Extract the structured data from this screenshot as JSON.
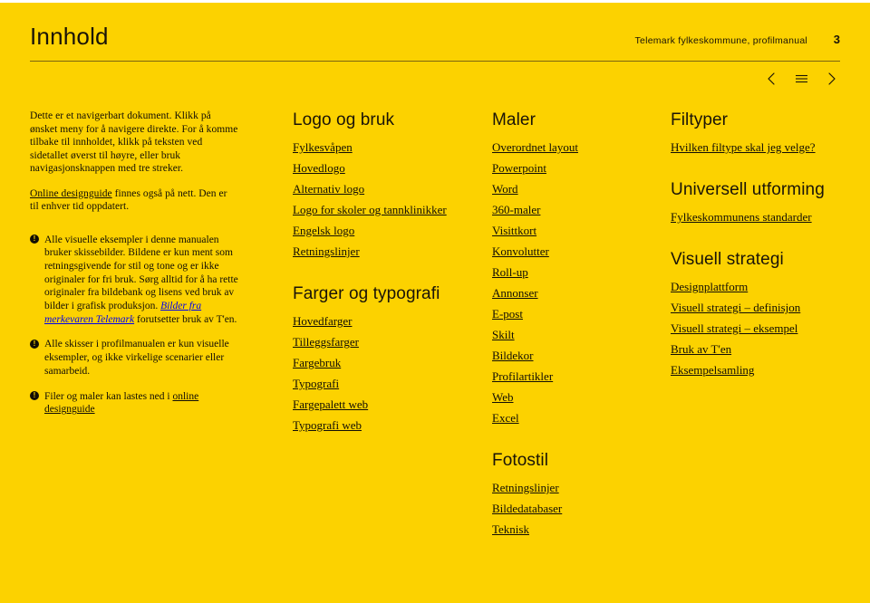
{
  "header": {
    "title": "Innhold",
    "doc_title": "Telemark fylkeskommune, profilmanual",
    "page_number": "3",
    "nav": {
      "prev_label": "Forrige side",
      "menu_label": "Meny",
      "next_label": "Neste side"
    }
  },
  "colors": {
    "background": "#fcd200",
    "text": "#120e05",
    "rule": "#7b6410"
  },
  "intro": {
    "paragraph_1": "Dette er et navigerbart dokument. Klikk på ønsket meny for å navigere direkte. For å komme tilbake til innholdet, klikk på teksten ved sidetallet øverst til høyre, eller bruk navigasjonsknappen med tre streker.",
    "paragraph_2_link": "Online designguide",
    "paragraph_2_rest": " finnes også på nett. Den er til enhver tid oppdatert.",
    "notes": [
      {
        "badge": "!",
        "text_1": "Alle visuelle eksempler i denne manualen bruker skissebilder. Bildene er kun ment som retningsgivende for stil og tone og er ikke originaler for fri bruk. Sørg alltid for å ha rette originaler fra bildebank og lisens ved bruk av bilder i grafisk produksjon. ",
        "link": "Bilder fra merkevaren Telemark",
        "text_2": " forutsetter bruk av T'en."
      },
      {
        "badge": "!",
        "text_1": "Alle skisser i profilmanualen er kun visuelle eksempler, og ikke virkelige scenarier eller samarbeid.",
        "link": "",
        "text_2": ""
      },
      {
        "badge": "!",
        "text_1": "Filer og maler kan lastes ned i ",
        "link": "online designguide",
        "text_2": ""
      }
    ]
  },
  "sections": [
    {
      "heading": "Logo og bruk",
      "items": [
        "Fylkesvåpen",
        "Hovedlogo",
        "Alternativ logo",
        "Logo for skoler og tannklinikker",
        "Engelsk logo",
        "Retningslinjer"
      ]
    },
    {
      "heading": "Farger og typografi",
      "items": [
        "Hovedfarger",
        "Tilleggsfarger",
        "Fargebruk",
        "Typografi",
        "Fargepalett web",
        "Typografi web"
      ]
    },
    {
      "heading": "Maler",
      "items": [
        "Overordnet layout",
        "Powerpoint",
        "Word",
        "360-maler",
        "Visittkort",
        "Konvolutter",
        "Roll-up",
        "Annonser",
        "E-post",
        "Skilt",
        "Bildekor",
        "Profilartikler",
        "Web",
        "Excel"
      ]
    },
    {
      "heading": "Fotostil",
      "items": [
        "Retningslinjer",
        "Bildedatabaser",
        "Teknisk"
      ]
    },
    {
      "heading": "Filtyper",
      "items": [
        "Hvilken filtype skal jeg velge?"
      ]
    },
    {
      "heading": "Universell utforming",
      "items": [
        "Fylkeskommunens standarder"
      ]
    },
    {
      "heading": "Visuell strategi",
      "items": [
        "Designplattform",
        "Visuell strategi – definisjon ",
        "Visuell strategi – eksempel",
        "Bruk av T'en",
        "Eksempelsamling"
      ]
    }
  ]
}
